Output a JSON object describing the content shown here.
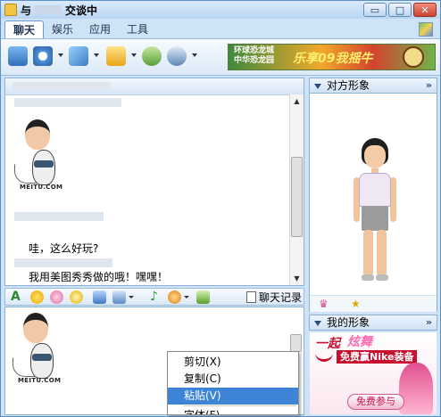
{
  "window": {
    "title_prefix": "与",
    "title_suffix": "交谈中",
    "buttons": {
      "minimize": "▭",
      "maximize": "□",
      "close": "✕"
    }
  },
  "tabs": [
    {
      "label": "聊天",
      "active": true
    },
    {
      "label": "娱乐",
      "active": false
    },
    {
      "label": "应用",
      "active": false
    },
    {
      "label": "工具",
      "active": false
    }
  ],
  "banner": {
    "line1": "环球恐龙城",
    "line2": "中华恐龙园",
    "main": "乐享09我摇牛"
  },
  "chat": {
    "messages": [
      {
        "text": "哇，这么好玩?"
      },
      {
        "text": "我用美图秀秀做的哦！嘿嘿！"
      }
    ],
    "avatar_label": "MEITU.COM"
  },
  "input_toolbar": {
    "history_label": "聊天记录"
  },
  "context_menu": {
    "items": [
      {
        "label": "剪切(X)",
        "selected": false
      },
      {
        "label": "复制(C)",
        "selected": false
      },
      {
        "label": "粘贴(V)",
        "selected": true
      },
      {
        "label": "字体(F)",
        "selected": false
      }
    ]
  },
  "right_panel": {
    "peer_title": "对方形象",
    "my_title": "我的形象",
    "collapse_glyph": "»"
  },
  "ad": {
    "line1a": "一起",
    "line1b": "炫舞",
    "line2": "免费赢Nike装备",
    "button": "免费参与"
  },
  "colors": {
    "accent": "#3d84d6",
    "window_bg": "#cfe3f6",
    "border": "#8fb0d6"
  }
}
